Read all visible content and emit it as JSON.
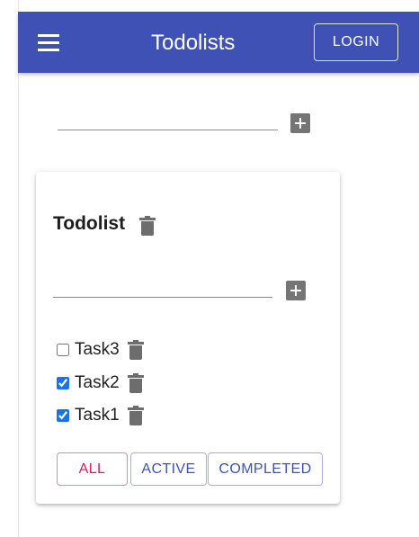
{
  "appbar": {
    "title": "Todolists",
    "login_label": "LOGIN",
    "menu_icon": "hamburger-menu-icon",
    "color": "#3f51b5"
  },
  "new_list": {
    "input_value": "",
    "add_icon": "add-box-icon"
  },
  "todolist": {
    "title": "Todolist",
    "delete_icon": "trash-icon",
    "new_task_input_value": "",
    "tasks": [
      {
        "label": "Task3",
        "done": false
      },
      {
        "label": "Task2",
        "done": true
      },
      {
        "label": "Task1",
        "done": true
      }
    ],
    "filters": {
      "all": "ALL",
      "active": "ACTIVE",
      "completed": "COMPLETED",
      "selected": "all"
    }
  }
}
